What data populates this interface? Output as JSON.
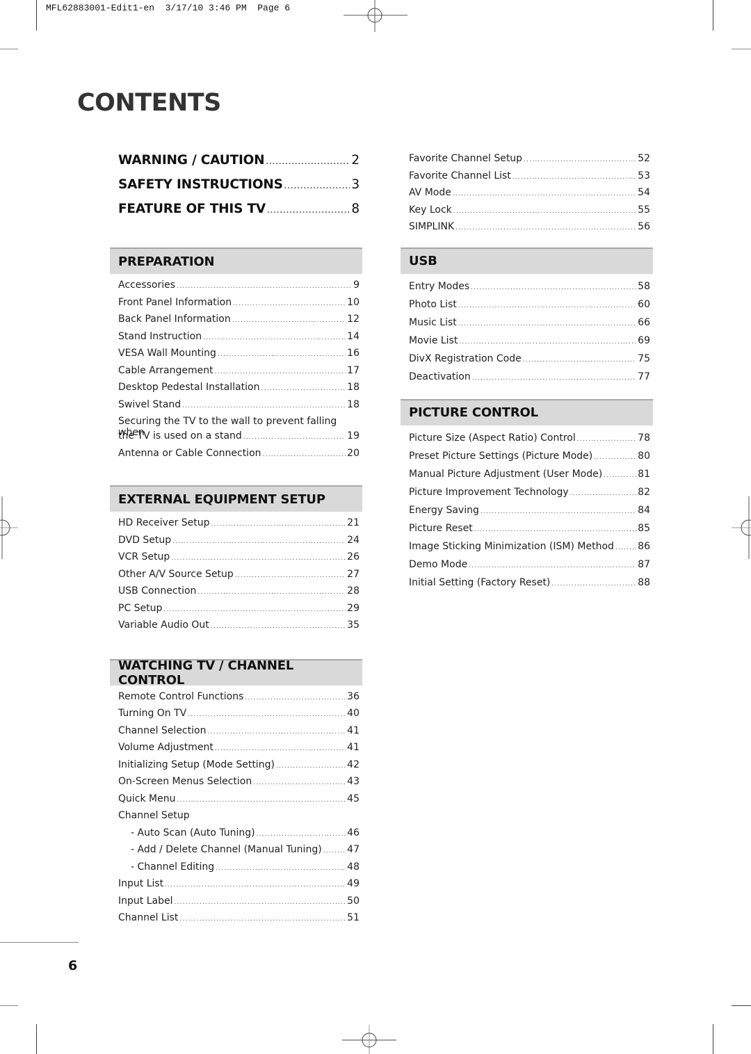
{
  "slug": "MFL62883001-Edit1-en  3/17/10 3:46 PM  Page 6",
  "title": "CONTENTS",
  "page_number": "6",
  "top_entries": [
    {
      "label": "WARNING / CAUTION",
      "page": "2"
    },
    {
      "label": "SAFETY INSTRUCTIONS",
      "page": "3"
    },
    {
      "label": "FEATURE OF THIS TV",
      "page": "8"
    }
  ],
  "preparation": {
    "heading": "PREPARATION",
    "items": [
      {
        "label": "Accessories",
        "page": "9"
      },
      {
        "label": "Front Panel Information",
        "page": "10"
      },
      {
        "label": "Back Panel Information",
        "page": "12"
      },
      {
        "label": "Stand Instruction",
        "page": "14"
      },
      {
        "label": "VESA Wall Mounting",
        "page": "16"
      },
      {
        "label": "Cable Arrangement",
        "page": "17"
      },
      {
        "label": "Desktop Pedestal Installation",
        "page": "18"
      },
      {
        "label": "Swivel Stand",
        "page": "18"
      },
      {
        "label_line1": "Securing the TV to the wall to prevent falling when",
        "label_line2": "the TV is used on a stand",
        "page": "19"
      },
      {
        "label": "Antenna or Cable Connection",
        "page": "20"
      }
    ]
  },
  "external": {
    "heading": "EXTERNAL EQUIPMENT SETUP",
    "items": [
      {
        "label": "HD Receiver Setup",
        "page": "21"
      },
      {
        "label": "DVD Setup",
        "page": "24"
      },
      {
        "label": "VCR Setup",
        "page": "26"
      },
      {
        "label": "Other A/V Source Setup",
        "page": "27"
      },
      {
        "label": "USB Connection",
        "page": "28"
      },
      {
        "label": "PC Setup",
        "page": "29"
      },
      {
        "label": "Variable Audio Out",
        "page": "35"
      }
    ]
  },
  "watching": {
    "heading": "WATCHING TV / CHANNEL CONTROL",
    "items": [
      {
        "label": "Remote Control Functions",
        "page": "36"
      },
      {
        "label": "Turning On TV",
        "page": "40"
      },
      {
        "label": "Channel Selection",
        "page": "41"
      },
      {
        "label": "Volume Adjustment",
        "page": "41"
      },
      {
        "label": "Initializing Setup (Mode Setting)",
        "page": "42"
      },
      {
        "label": "On-Screen Menus Selection",
        "page": "43"
      },
      {
        "label": "Quick Menu",
        "page": "45"
      },
      {
        "label": "Channel Setup"
      },
      {
        "label": "- Auto Scan (Auto Tuning)",
        "page": "46"
      },
      {
        "label": "- Add / Delete Channel (Manual Tuning)",
        "page": "47"
      },
      {
        "label": "- Channel Editing",
        "page": "48"
      },
      {
        "label": "Input List",
        "page": "49"
      },
      {
        "label": "Input Label",
        "page": "50"
      },
      {
        "label": "Channel List",
        "page": "51"
      }
    ]
  },
  "watching_cont": {
    "items": [
      {
        "label": "Favorite Channel Setup",
        "page": "52"
      },
      {
        "label": "Favorite Channel List",
        "page": "53"
      },
      {
        "label": "AV Mode",
        "page": "54"
      },
      {
        "label": "Key Lock",
        "page": "55"
      },
      {
        "label": "SIMPLINK",
        "page": "56"
      }
    ]
  },
  "usb": {
    "heading": "USB",
    "items": [
      {
        "label": "Entry Modes",
        "page": "58"
      },
      {
        "label": "Photo List",
        "page": "60"
      },
      {
        "label": "Music List",
        "page": "66"
      },
      {
        "label": "Movie List",
        "page": "69"
      },
      {
        "label": "DivX Registration Code",
        "page": "75"
      },
      {
        "label": "Deactivation",
        "page": "77"
      }
    ]
  },
  "picture": {
    "heading": "PICTURE CONTROL",
    "items": [
      {
        "label": "Picture Size (Aspect Ratio) Control",
        "page": "78"
      },
      {
        "label": "Preset Picture Settings (Picture Mode)",
        "page": "80"
      },
      {
        "label": "Manual Picture Adjustment (User Mode)",
        "page": "81"
      },
      {
        "label": "Picture Improvement Technology",
        "page": "82"
      },
      {
        "label": "Energy Saving",
        "page": "84"
      },
      {
        "label": "Picture Reset",
        "page": "85"
      },
      {
        "label": "Image Sticking Minimization (ISM) Method",
        "page": "86"
      },
      {
        "label": "Demo Mode",
        "page": "87"
      },
      {
        "label": "Initial Setting (Factory Reset)",
        "page": "88"
      }
    ]
  }
}
